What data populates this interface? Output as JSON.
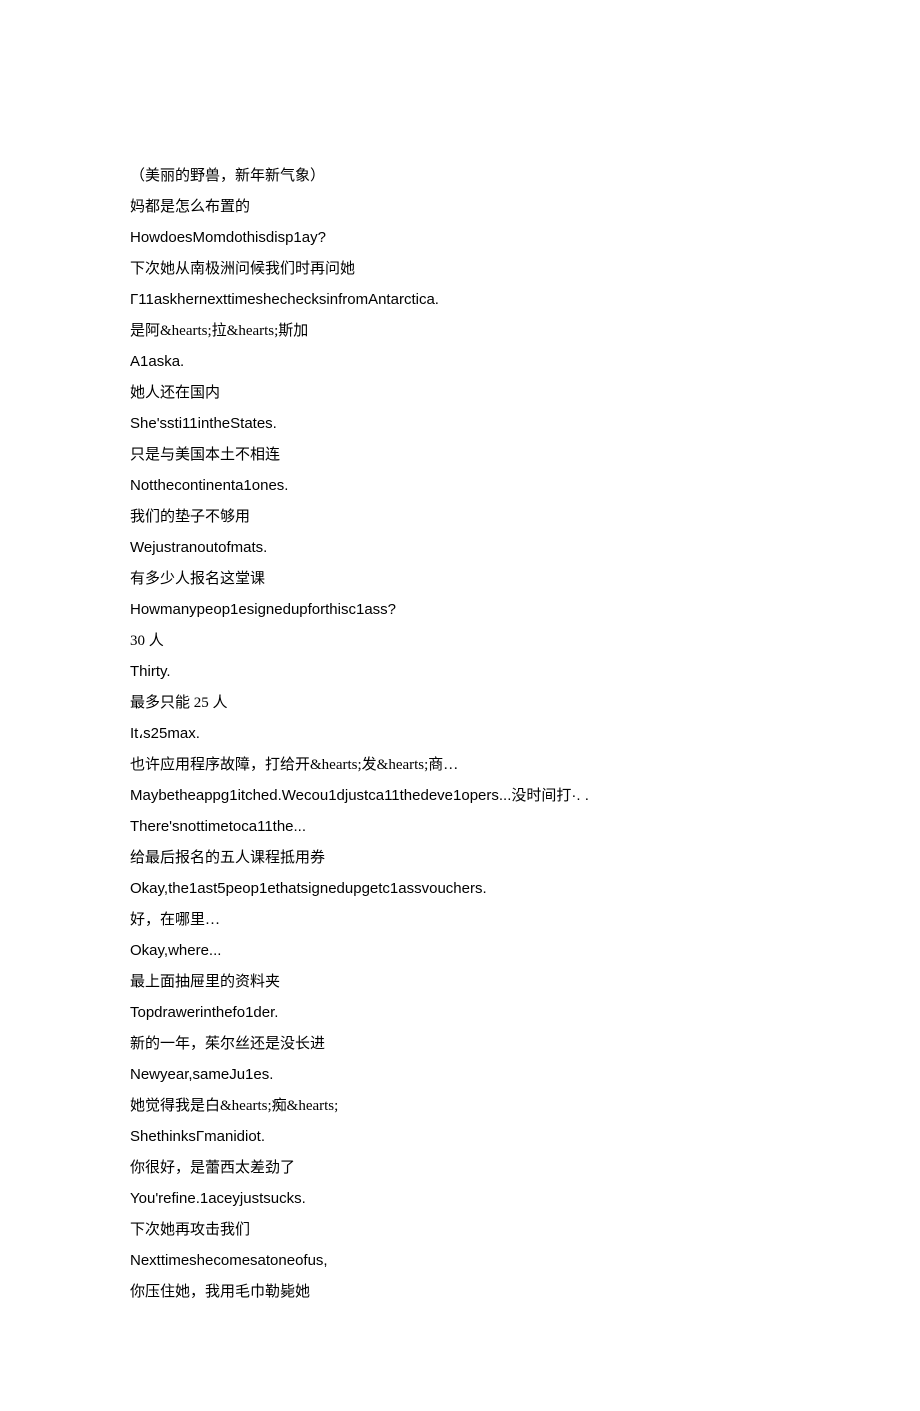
{
  "lines": [
    {
      "text": "（美丽的野兽，新年新气象）",
      "cls": ""
    },
    {
      "text": "妈都是怎么布置的",
      "cls": ""
    },
    {
      "text": "HowdoesMomdothisdisp1ay?",
      "cls": "en"
    },
    {
      "text": "下次她从南极洲问候我们时再问她",
      "cls": ""
    },
    {
      "text": "Γ11askhernexttimeshechecksinfromAntarctica.",
      "cls": "en"
    },
    {
      "text": "是阿&hearts;拉&hearts;斯加",
      "cls": ""
    },
    {
      "text": "A1aska.",
      "cls": "en"
    },
    {
      "text": "她人还在国内",
      "cls": ""
    },
    {
      "text": "She'ssti11intheStates.",
      "cls": "en"
    },
    {
      "text": "只是与美国本土不相连",
      "cls": ""
    },
    {
      "text": "Notthecontinenta1ones.",
      "cls": "en"
    },
    {
      "text": "我们的垫子不够用",
      "cls": ""
    },
    {
      "text": "Wejustranoutofmats.",
      "cls": "en"
    },
    {
      "text": "有多少人报名这堂课",
      "cls": ""
    },
    {
      "text": "Howmanypeop1esignedupforthisc1ass?",
      "cls": "en"
    },
    {
      "text": "30 人",
      "cls": ""
    },
    {
      "text": "Thirty.",
      "cls": "en"
    },
    {
      "text": "最多只能 25 人",
      "cls": ""
    },
    {
      "text": "It،s25max.",
      "cls": "en"
    },
    {
      "text": "也许应用程序故障，打给开&hearts;发&hearts;商…",
      "cls": ""
    },
    {
      "text": "Maybetheappg1itched.Wecou1djustca11thedeve1opers...没时间打·. .",
      "cls": "en"
    },
    {
      "text": "There'snottimetoca11the...",
      "cls": "en"
    },
    {
      "text": "给最后报名的五人课程抵用券",
      "cls": ""
    },
    {
      "text": "Okay,the1ast5peop1ethatsignedupgetc1assvouchers.",
      "cls": "en"
    },
    {
      "text": "好，在哪里…",
      "cls": ""
    },
    {
      "text": "Okay,where...",
      "cls": "en"
    },
    {
      "text": "最上面抽屉里的资料夹",
      "cls": ""
    },
    {
      "text": "Topdrawerinthefo1der.",
      "cls": "en"
    },
    {
      "text": "新的一年，茱尔丝还是没长进",
      "cls": ""
    },
    {
      "text": "Newyear,sameJu1es.",
      "cls": "en"
    },
    {
      "text": "她觉得我是白&hearts;痴&hearts;",
      "cls": ""
    },
    {
      "text": "ShethinksΓmanidiot.",
      "cls": "en"
    },
    {
      "text": "你很好，是蕾西太差劲了",
      "cls": ""
    },
    {
      "text": "You'refine.1aceyjustsucks.",
      "cls": "en"
    },
    {
      "text": "下次她再攻击我们",
      "cls": ""
    },
    {
      "text": "Nexttimeshecomesatoneofus,",
      "cls": "en"
    },
    {
      "text": "你压住她，我用毛巾勒毙她",
      "cls": ""
    }
  ]
}
